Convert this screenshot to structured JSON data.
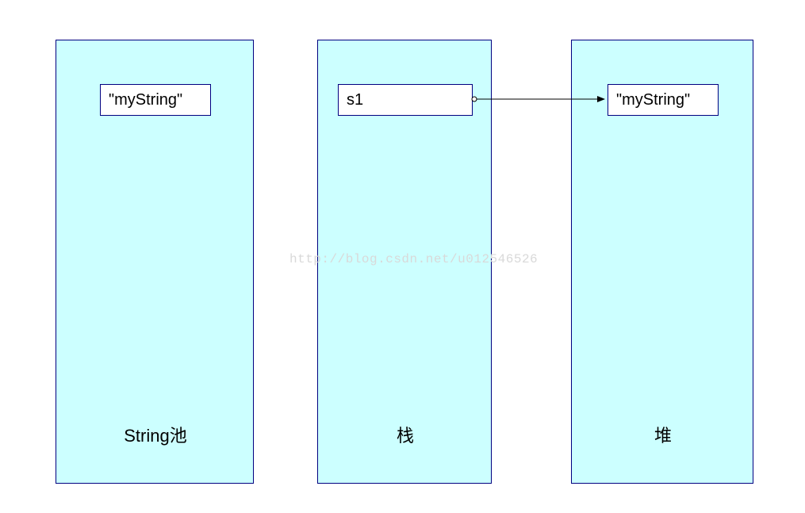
{
  "regions": {
    "stringPool": {
      "label": "String池",
      "node": "\"myString\""
    },
    "stack": {
      "label": "栈",
      "node": "s1"
    },
    "heap": {
      "label": "堆",
      "node": "\"myString\""
    }
  },
  "watermark": "http://blog.csdn.net/u012546526",
  "chart_data": {
    "type": "diagram",
    "title": "",
    "regions": [
      {
        "name": "String池",
        "contents": [
          "\"myString\""
        ]
      },
      {
        "name": "栈",
        "contents": [
          "s1"
        ]
      },
      {
        "name": "堆",
        "contents": [
          "\"myString\""
        ]
      }
    ],
    "edges": [
      {
        "from": "s1",
        "from_region": "栈",
        "to": "\"myString\"",
        "to_region": "堆"
      }
    ]
  }
}
